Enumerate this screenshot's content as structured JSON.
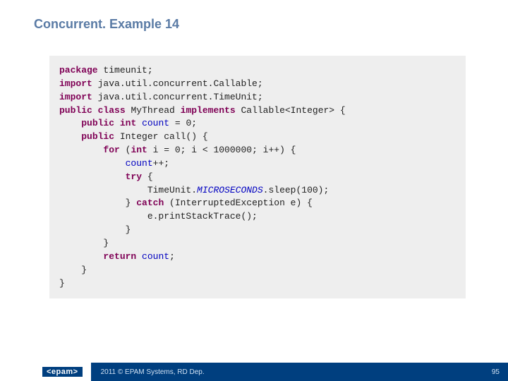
{
  "header": {
    "title": "Concurrent. Example 14"
  },
  "code": {
    "l1_kw": "package",
    "l1_rest": " timeunit;",
    "l2_kw": "import",
    "l2_rest": " java.util.concurrent.Callable;",
    "l3_kw": "import",
    "l3_rest": " java.util.concurrent.TimeUnit;",
    "l4_kw1": "public",
    "l4_kw2": "class",
    "l4_mid": " MyThread ",
    "l4_kw3": "implements",
    "l4_rest": " Callable<Integer> {",
    "l5_ind": "    ",
    "l5_kw1": "public",
    "l5_sp1": " ",
    "l5_kw2": "int",
    "l5_sp2": " ",
    "l5_fld": "count",
    "l5_rest": " = 0;",
    "l6_ind": "    ",
    "l6_kw": "public",
    "l6_rest": " Integer call() {",
    "l7_ind": "        ",
    "l7_kw1": "for",
    "l7_a": " (",
    "l7_kw2": "int",
    "l7_rest": " i = 0; i < 1000000; i++) {",
    "l8_ind": "            ",
    "l8_fld": "count",
    "l8_rest": "++;",
    "l9_ind": "            ",
    "l9_kw": "try",
    "l9_rest": " {",
    "l10_ind": "                ",
    "l10_a": "TimeUnit.",
    "l10_sit": "MICROSECONDS",
    "l10_rest": ".sleep(100);",
    "l11_ind": "            ",
    "l11_a": "} ",
    "l11_kw": "catch",
    "l11_rest": " (InterruptedException e) {",
    "l12": "                e.printStackTrace();",
    "l13": "            }",
    "l14": "        }",
    "l15_ind": "        ",
    "l15_kw": "return",
    "l15_sp": " ",
    "l15_fld": "count",
    "l15_rest": ";",
    "l16": "    }",
    "l17": "}"
  },
  "footer": {
    "logo": "<epam>",
    "copyright": "2011 © EPAM Systems, RD Dep.",
    "page": "95"
  }
}
